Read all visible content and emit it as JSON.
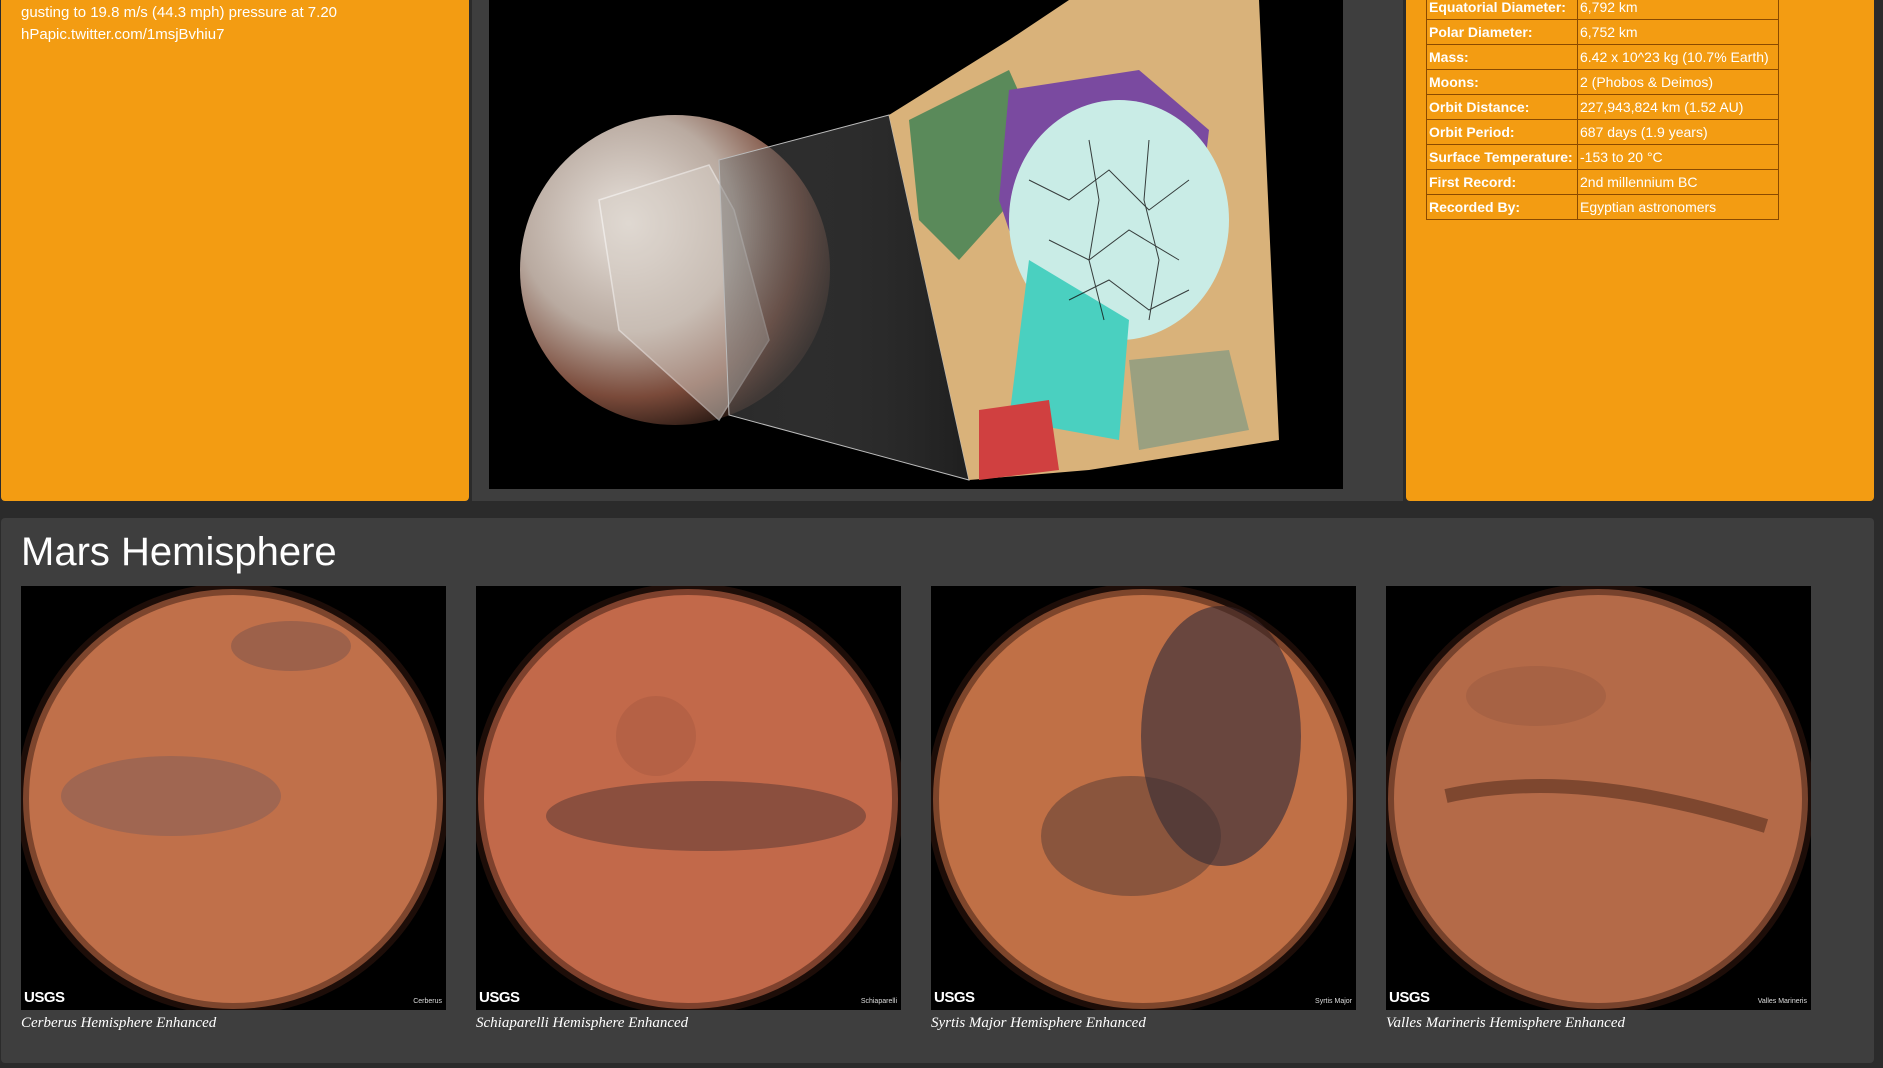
{
  "weather_tweet": {
    "line1": "gusting to 19.8 m/s (44.3 mph) pressure at 7.20",
    "link": "hPapic.twitter.com/1msjBvhiu7"
  },
  "facts": [
    {
      "label": "Equatorial Diameter:",
      "value": "6,792 km"
    },
    {
      "label": "Polar Diameter:",
      "value": "6,752 km"
    },
    {
      "label": "Mass:",
      "value": "6.42 x 10^23 kg (10.7% Earth)"
    },
    {
      "label": "Moons:",
      "value": "2 (Phobos & Deimos)"
    },
    {
      "label": "Orbit Distance:",
      "value": "227,943,824 km (1.52 AU)"
    },
    {
      "label": "Orbit Period:",
      "value": "687 days (1.9 years)"
    },
    {
      "label": "Surface Temperature:",
      "value": "-153 to 20 °C"
    },
    {
      "label": "First Record:",
      "value": "2nd millennium BC"
    },
    {
      "label": "Recorded By:",
      "value": "Egyptian astronomers"
    }
  ],
  "hemispheres": {
    "title": "Mars Hemisphere",
    "items": [
      {
        "caption": "Cerberus Hemisphere Enhanced",
        "badge": "USGS",
        "plate_name": "Cerberus",
        "tint": "#c0704a"
      },
      {
        "caption": "Schiaparelli Hemisphere Enhanced",
        "badge": "USGS",
        "plate_name": "Schiaparelli",
        "tint": "#c2694a"
      },
      {
        "caption": "Syrtis Major Hemisphere Enhanced",
        "badge": "USGS",
        "plate_name": "Syrtis Major",
        "tint": "#c07046"
      },
      {
        "caption": "Valles Marineris Hemisphere Enhanced",
        "badge": "USGS",
        "plate_name": "Valles Marineris",
        "tint": "#b46a48"
      }
    ]
  }
}
